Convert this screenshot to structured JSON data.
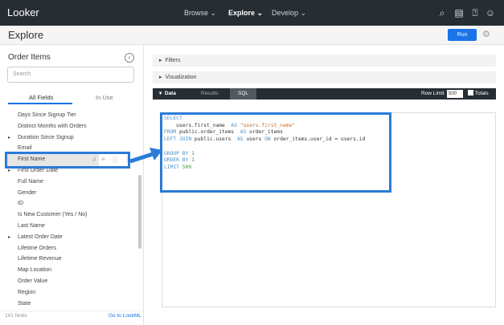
{
  "topbar": {
    "logo": "Looker",
    "nav": [
      "Browse",
      "Explore",
      "Develop"
    ],
    "active": "Explore",
    "icons": [
      "search-icon",
      "marketplace-icon",
      "help-icon",
      "account-icon"
    ]
  },
  "header": {
    "title": "Explore",
    "run": "Run"
  },
  "sidebar": {
    "title": "Order Items",
    "search_placeholder": "Search",
    "tabs": [
      "All Fields",
      "In Use"
    ],
    "fields": [
      {
        "label": "Days Since Signup Tier",
        "group": false
      },
      {
        "label": "Distinct Months with Orders",
        "group": false
      },
      {
        "label": "Duration Since Signup",
        "group": true
      },
      {
        "label": "Email",
        "group": false
      },
      {
        "label": "First Name",
        "group": false,
        "selected": true
      },
      {
        "label": "First Order Date",
        "group": true
      },
      {
        "label": "Full Name",
        "group": false
      },
      {
        "label": "Gender",
        "group": false
      },
      {
        "label": "ID",
        "group": false
      },
      {
        "label": "Is New Customer (Yes / No)",
        "group": false
      },
      {
        "label": "Last Name",
        "group": false
      },
      {
        "label": "Latest Order Date",
        "group": true
      },
      {
        "label": "Lifetime Orders",
        "group": false
      },
      {
        "label": "Lifetime Revenue",
        "group": false
      },
      {
        "label": "Map Location",
        "group": false
      },
      {
        "label": "Order Value",
        "group": false
      },
      {
        "label": "Region",
        "group": false
      },
      {
        "label": "State",
        "group": false
      }
    ],
    "count": "141 fields",
    "lookml_link": "Go to LookML"
  },
  "main": {
    "filters": "Filters",
    "visualization": "Visualization",
    "data_tabs": [
      "Data",
      "Results",
      "SQL"
    ],
    "active_tab": "SQL",
    "row_limit_label": "Row Limit",
    "row_limit": "500",
    "totals": "Totals"
  },
  "sql": {
    "l1": "SELECT",
    "l2a": "    users.first_name  ",
    "l2b": "AS ",
    "l2c": "\"users.first_name\"",
    "l3a": "FROM ",
    "l3b": "public.order_items  ",
    "l3c": "AS ",
    "l3d": "order_items",
    "l4a": "LEFT JOIN ",
    "l4b": "public.users  ",
    "l4c": "AS ",
    "l4d": "users ",
    "l4e": "ON ",
    "l4f": "order_items.user_id = users.id",
    "l6a": "GROUP BY ",
    "l6b": "1",
    "l7a": "ORDER BY ",
    "l7b": "1",
    "l8a": "LIMIT ",
    "l8b": "500"
  },
  "colors": {
    "accent": "#1a73e8",
    "topbar": "#262d33",
    "highlight": "#2b7bd9"
  }
}
